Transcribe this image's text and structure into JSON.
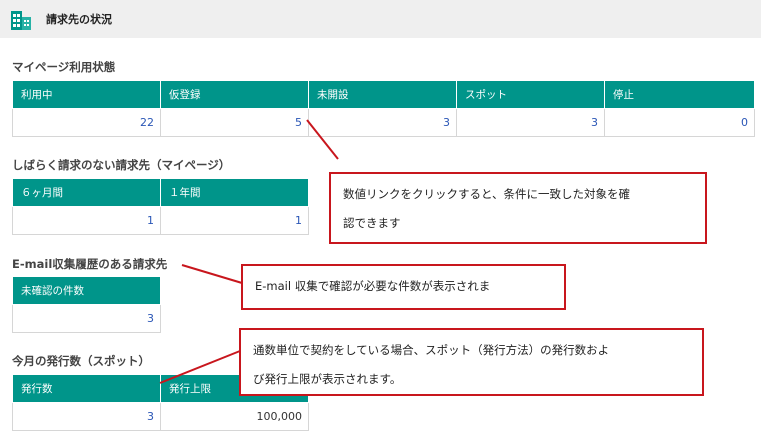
{
  "header": {
    "title": "請求先の状況",
    "icon": "building-icon"
  },
  "sections": {
    "mypage": {
      "title": "マイページ利用状態",
      "headers": [
        "利用中",
        "仮登録",
        "未開設",
        "スポット",
        "停止"
      ],
      "values": [
        "22",
        "5",
        "3",
        "3",
        "0"
      ]
    },
    "no_request": {
      "title": "しばらく請求のない請求先（マイページ）",
      "headers": [
        "６ヶ月間",
        "１年間"
      ],
      "values": [
        "1",
        "1"
      ]
    },
    "email": {
      "title": "E-mail収集履歴のある請求先",
      "headers": [
        "未確認の件数"
      ],
      "values": [
        "3"
      ]
    },
    "issue": {
      "title": "今月の発行数（スポット）",
      "headers": [
        "発行数",
        "発行上限"
      ],
      "values": [
        "3",
        "100,000"
      ]
    }
  },
  "callouts": {
    "link": {
      "line1": "数値リンクをクリックすると、条件に一致した対象を確",
      "line2": "認できます"
    },
    "email": {
      "line1": "E-mail 収集で確認が必要な件数が表示されま"
    },
    "spot": {
      "line1": "通数単位で契約をしている場合、スポット（発行方法）の発行数およ",
      "line2": "び発行上限が表示されます。"
    }
  },
  "colors": {
    "accent": "#00958a",
    "callout_border": "#c8161d",
    "link": "#2a56b6"
  }
}
